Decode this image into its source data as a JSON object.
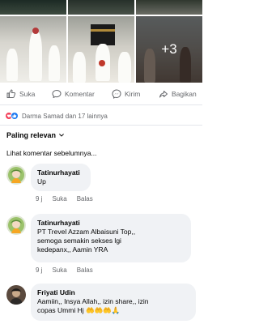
{
  "photos": {
    "more_count": "+3"
  },
  "actions": {
    "like": "Suka",
    "comment": "Komentar",
    "send": "Kirim",
    "share": "Bagikan"
  },
  "reactions": {
    "summary": "Darma Samad dan 17 lainnya"
  },
  "sort": {
    "label": "Paling relevan"
  },
  "previous_comments": "Lihat komentar sebelumnya...",
  "comments": [
    {
      "author": "Tatinurhayati",
      "lines": [
        "Up"
      ],
      "time": "9 j",
      "like": "Suka",
      "reply": "Balas"
    },
    {
      "author": "Tatinurhayati",
      "lines": [
        "PT Trevel Azzam Albaisuni Top,,",
        "semoga semakin sekses lgi",
        "kedepanx,, Aamin YRA"
      ],
      "time": "9 j",
      "like": "Suka",
      "reply": "Balas"
    },
    {
      "author": "Friyati Udin",
      "lines": [
        "Aamiin,, Insya Allah,, izin share,, izin",
        "copas Ummi Hj 🤲🤲🤲🙏"
      ]
    }
  ],
  "colors": {
    "like_blue": "#1877f2",
    "love_red": "#f33e58",
    "bubble": "#f0f2f5",
    "muted": "#65676b"
  }
}
